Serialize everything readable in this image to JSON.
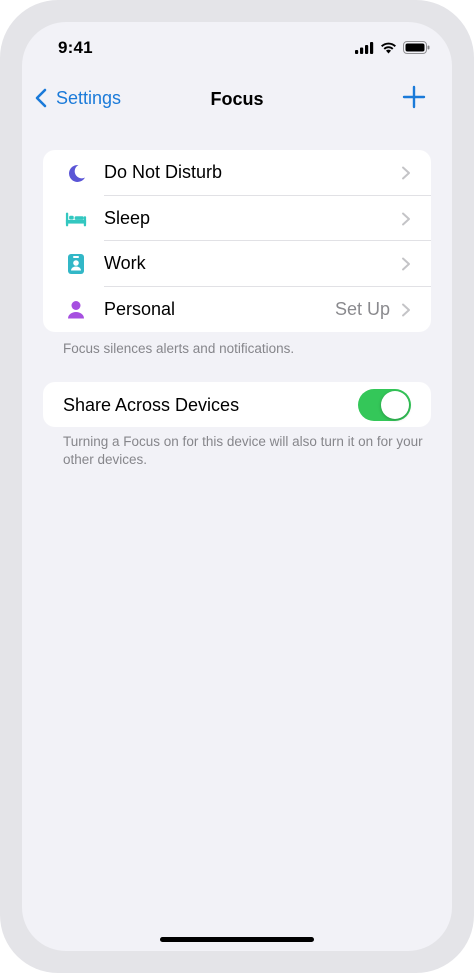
{
  "status_bar": {
    "time": "9:41",
    "icons": [
      "cellular-signal-icon",
      "wifi-icon",
      "battery-icon"
    ]
  },
  "nav": {
    "back_label": "Settings",
    "title": "Focus",
    "add_icon": "plus-icon"
  },
  "focus_modes": [
    {
      "label": "Do Not Disturb",
      "icon": "moon-icon",
      "color": "#5a55d6",
      "detail": ""
    },
    {
      "label": "Sleep",
      "icon": "bed-icon",
      "color": "#33c7c0",
      "detail": ""
    },
    {
      "label": "Work",
      "icon": "id-badge-icon",
      "color": "#32b7c7",
      "detail": ""
    },
    {
      "label": "Personal",
      "icon": "person-icon",
      "color": "#a64fe0",
      "detail": "Set Up"
    }
  ],
  "focus_footnote": "Focus silences alerts and notifications.",
  "share": {
    "label": "Share Across Devices",
    "enabled": true,
    "toggle_color": "#34c759",
    "footnote": "Turning a Focus on for this device will also turn it on for your other devices."
  },
  "colors": {
    "accent": "#1a7ad9",
    "background": "#f2f2f7"
  }
}
